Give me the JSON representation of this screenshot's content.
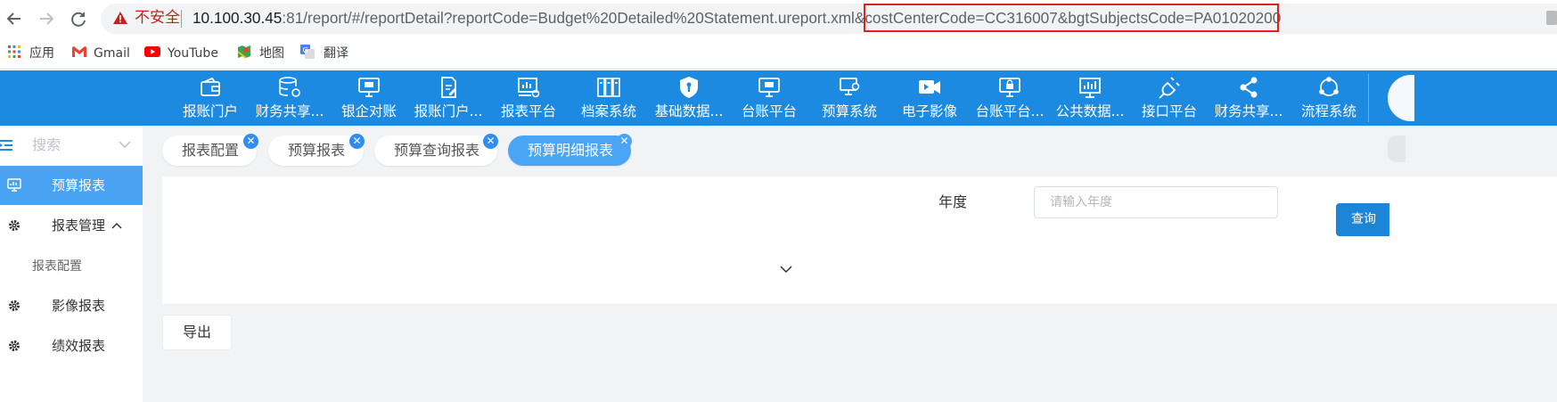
{
  "browser": {
    "security_label": "不安全",
    "url_host": "10.100.30.45",
    "url_rest": ":81/report/#/reportDetail?reportCode=Budget%20Detailed%20Statement.ureport.xml&costCenterCode=CC316007&bgtSubjectsCode=PA01020200",
    "accent_warning_color": "#c5221f",
    "highlight_color": "#e0211b"
  },
  "bookmarks": [
    {
      "label": "应用",
      "icon": "apps-grid-icon"
    },
    {
      "label": "Gmail",
      "icon": "gmail-icon"
    },
    {
      "label": "YouTube",
      "icon": "youtube-icon"
    },
    {
      "label": "地图",
      "icon": "maps-icon"
    },
    {
      "label": "翻译",
      "icon": "translate-icon"
    }
  ],
  "topnav": {
    "background": "#1c8ae0",
    "items": [
      {
        "label": "报账门户",
        "icon": "wallet-icon"
      },
      {
        "label": "财务共享...",
        "icon": "database-gear-icon"
      },
      {
        "label": "银企对账",
        "icon": "monitor-icon"
      },
      {
        "label": "报账门户...",
        "icon": "document-edit-icon"
      },
      {
        "label": "报表平台",
        "icon": "chart-gear-icon"
      },
      {
        "label": "档案系统",
        "icon": "archive-icon"
      },
      {
        "label": "基础数据...",
        "icon": "shield-icon"
      },
      {
        "label": "台账平台",
        "icon": "monitor-icon"
      },
      {
        "label": "预算系统",
        "icon": "screen-gear-icon"
      },
      {
        "label": "电子影像",
        "icon": "video-camera-icon"
      },
      {
        "label": "台账平台...",
        "icon": "monitor-lock-icon"
      },
      {
        "label": "公共数据...",
        "icon": "bar-chart-icon"
      },
      {
        "label": "接口平台",
        "icon": "plug-icon"
      },
      {
        "label": "财务共享...",
        "icon": "share-icon"
      },
      {
        "label": "流程系统",
        "icon": "flow-cycle-icon"
      }
    ]
  },
  "sidebar": {
    "search_placeholder": "搜索",
    "items": [
      {
        "label": "预算报表",
        "icon": "report-monitor-icon",
        "active": true
      },
      {
        "label": "报表管理",
        "icon": "gear-icon",
        "expanded": true
      },
      {
        "label": "报表配置",
        "icon": "",
        "sub": true
      },
      {
        "label": "影像报表",
        "icon": "gear-icon"
      },
      {
        "label": "绩效报表",
        "icon": "gear-icon"
      }
    ]
  },
  "tabs": [
    {
      "label": "报表配置",
      "active": false
    },
    {
      "label": "预算报表",
      "active": false
    },
    {
      "label": "预算查询报表",
      "active": false
    },
    {
      "label": "预算明细报表",
      "active": true
    }
  ],
  "filter": {
    "year_label": "年度",
    "year_placeholder": "请输入年度",
    "year_value": "",
    "query_button": "查询"
  },
  "toolbar": {
    "export_button": "导出"
  }
}
